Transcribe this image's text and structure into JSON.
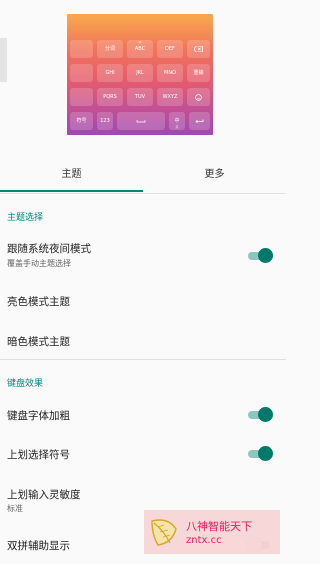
{
  "keyboard_preview": {
    "row1": [
      {
        "label": "",
        "sub": "",
        "icon": ""
      },
      {
        "label": "分词",
        "sub": "",
        "icon": ""
      },
      {
        "label": "ABC",
        "sub": "@",
        "icon": ""
      },
      {
        "label": "DEF",
        "sub": "",
        "icon": ""
      },
      {
        "label": "",
        "sub": "",
        "icon": "backspace-icon"
      }
    ],
    "row2": [
      {
        "label": "",
        "sub": "",
        "icon": ""
      },
      {
        "label": "GHI",
        "sub": "",
        "icon": ""
      },
      {
        "label": "JKL",
        "sub": "",
        "icon": ""
      },
      {
        "label": "MNO",
        "sub": "",
        "icon": ""
      },
      {
        "label": "重输",
        "sub": "",
        "icon": ""
      }
    ],
    "row3": [
      {
        "label": "",
        "sub": "",
        "icon": ""
      },
      {
        "label": "PQRS",
        "sub": "",
        "icon": ""
      },
      {
        "label": "TUV",
        "sub": "",
        "icon": ""
      },
      {
        "label": "WXYZ",
        "sub": "",
        "icon": ""
      },
      {
        "label": "",
        "sub": "",
        "icon": "emoji-icon"
      }
    ],
    "row4": [
      {
        "label": "符号",
        "sub": ""
      },
      {
        "label": "123",
        "sub": ""
      },
      {
        "label": "",
        "sub": "",
        "icon": "space-icon"
      },
      {
        "label": "中",
        "sub": "英"
      },
      {
        "label": "",
        "sub": "",
        "icon": "enter-icon"
      }
    ]
  },
  "tabs": [
    {
      "label": "主题",
      "active": true
    },
    {
      "label": "更多",
      "active": false
    }
  ],
  "sections": {
    "theme": {
      "header": "主题选择",
      "items": [
        {
          "title": "跟随系统夜间模式",
          "subtitle": "覆盖手动主题选择",
          "toggle": true
        },
        {
          "title": "亮色模式主题"
        },
        {
          "title": "暗色模式主题"
        }
      ]
    },
    "keyboard": {
      "header": "键盘效果",
      "items": [
        {
          "title": "键盘字体加粗",
          "toggle": true
        },
        {
          "title": "上划选择符号",
          "toggle": true
        },
        {
          "title": "上划输入灵敏度",
          "subtitle": "标准"
        },
        {
          "title": "双拼辅助显示",
          "toggle": false
        }
      ]
    }
  },
  "watermark": {
    "title": "八神智能天下",
    "url": "zntx.cc"
  },
  "colors": {
    "accent": "#00897b",
    "switch_thumb_on": "#00796b",
    "switch_track_on": "#8cc6bd",
    "watermark_text": "#e91e63"
  }
}
